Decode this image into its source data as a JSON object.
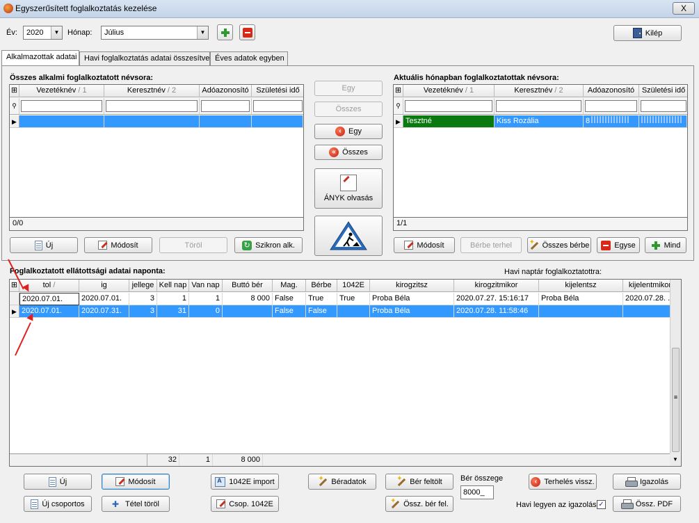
{
  "window": {
    "title": "Egyszerűsített foglalkoztatás kezelése",
    "close": "X"
  },
  "top": {
    "ev_label": "Év:",
    "ev_value": "2020",
    "honap_label": "Hónap:",
    "honap_value": "Július",
    "kilep": "Kilép"
  },
  "tabs": [
    "Alkalmazottak adatai",
    "Havi foglalkoztatás adatai összesítve",
    "Éves adatok egyben"
  ],
  "left_grid": {
    "title": "Összes alkalmi foglalkoztatott névsora:",
    "headers": [
      "Vezetéknév",
      "Keresztnév",
      "Adóazonosító",
      "Születési idő"
    ],
    "sort_marks": [
      "1",
      "2"
    ],
    "status": "0/0"
  },
  "middle": {
    "egy_disabled": "Egy",
    "osszes_disabled": "Összes",
    "egy": "Egy",
    "osszes": "Összes",
    "anyk": "ÁNYK olvasás"
  },
  "right_grid": {
    "title": "Aktuális hónapban foglalkoztatottak névsora:",
    "headers": [
      "Vezetéknév",
      "Keresztnév",
      "Adóazonosító",
      "Születési idő"
    ],
    "sort_marks": [
      "1",
      "2"
    ],
    "row": [
      "Tesztné",
      "Kiss Rozália",
      "8",
      ""
    ],
    "status": "1/1"
  },
  "left_buttons": {
    "uj": "Új",
    "modosit": "Módosít",
    "torol": "Töröl",
    "szikron": "Szikron alk."
  },
  "right_buttons": {
    "modosit": "Módosít",
    "berbe": "Bérbe terhel",
    "osszes_berbe": "Összes bérbe",
    "egyse": "Egyse",
    "mind": "Mind"
  },
  "bottom_grid": {
    "title": "Foglalkoztatott ellátottsági adatai naponta:",
    "naptar_label": "Havi naptár foglalkoztatottra:",
    "headers": [
      "tol",
      "ig",
      "jellege",
      "Kell nap",
      "Van nap",
      "Buttó bér",
      "Mag.",
      "Bérbe",
      "1042E",
      "kirogzitsz",
      "kirogzitmikor",
      "kijelentsz",
      "kijelentmikor"
    ],
    "rows": [
      [
        "2020.07.01.",
        "2020.07.01.",
        "3",
        "1",
        "1",
        "8 000",
        "False",
        "True",
        "True",
        "Proba Béla",
        "2020.07.27. 15:16:17",
        "Proba Béla",
        "2020.07.28. ..."
      ],
      [
        "2020.07.01.",
        "2020.07.31.",
        "3",
        "31",
        "0",
        "",
        "False",
        "False",
        "",
        "Proba Béla",
        "2020.07.28. 11:58:46",
        "",
        ""
      ]
    ],
    "totals": [
      "32",
      "1",
      "8 000"
    ]
  },
  "bottom_buttons": {
    "uj": "Új",
    "modosit": "Módosít",
    "import": "1042E import",
    "beradatok": "Béradatok",
    "ber_feltolt": "Bér feltölt",
    "terheles": "Terhelés vissz.",
    "igazolas": "Igazolás",
    "uj_csoportos": "Új csoportos",
    "tetel_torol": "Tétel töröl",
    "csop": "Csop. 1042E",
    "ossz_ber_fel": "Össz. bér fel.",
    "ossz_pdf": "Össz. PDF"
  },
  "ber_osszege": {
    "label": "Bér összege",
    "value": "8000_"
  },
  "havi_igazolas": {
    "label": "Havi legyen az igazolás",
    "checked": "✓"
  }
}
